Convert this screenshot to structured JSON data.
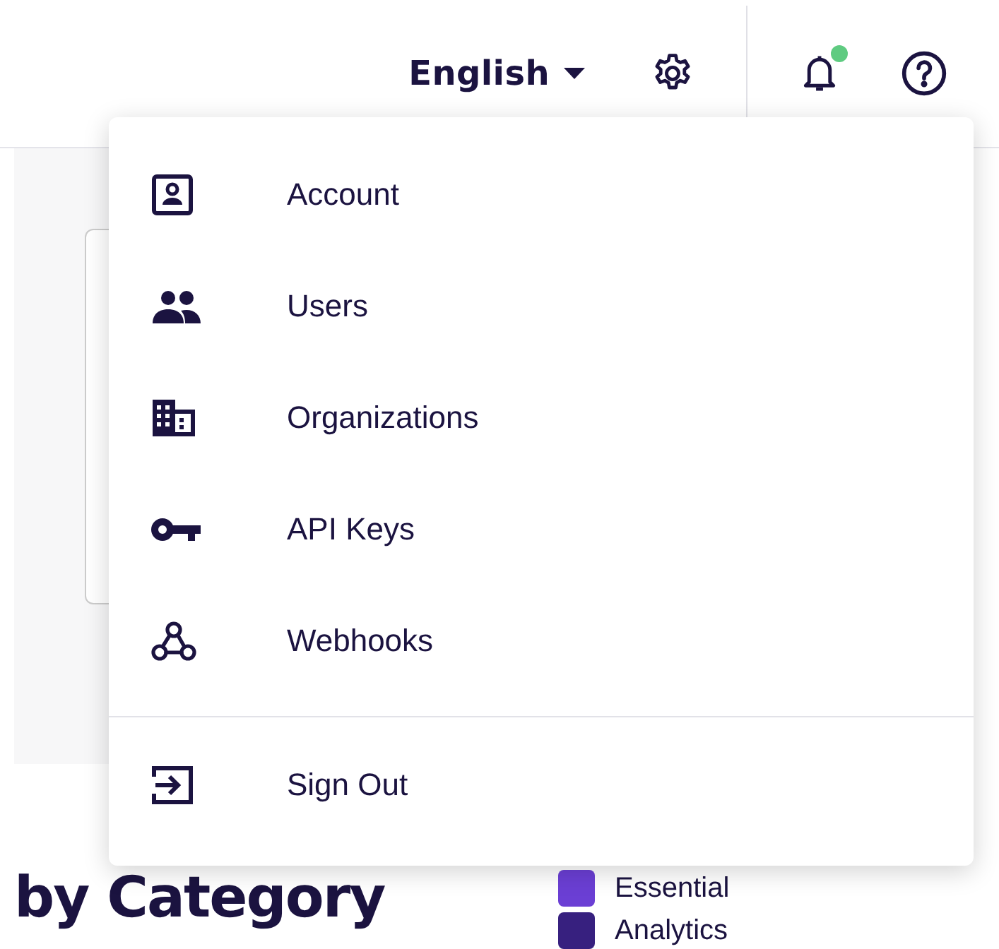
{
  "header": {
    "language": "English",
    "notifications": {
      "unread": true
    }
  },
  "menu": {
    "items": [
      {
        "kind": "account",
        "label": "Account"
      },
      {
        "kind": "users",
        "label": "Users"
      },
      {
        "kind": "organizations",
        "label": "Organizations"
      },
      {
        "kind": "keys",
        "label": "API Keys"
      },
      {
        "kind": "webhooks",
        "label": "Webhooks"
      }
    ],
    "footer_item": {
      "kind": "signout",
      "label": "Sign Out"
    }
  },
  "panel": {
    "heading": "by Category",
    "legend": [
      {
        "label": "Essential",
        "color": "#6b3fd4"
      },
      {
        "label": "Analytics",
        "color": "#37207f"
      }
    ]
  }
}
